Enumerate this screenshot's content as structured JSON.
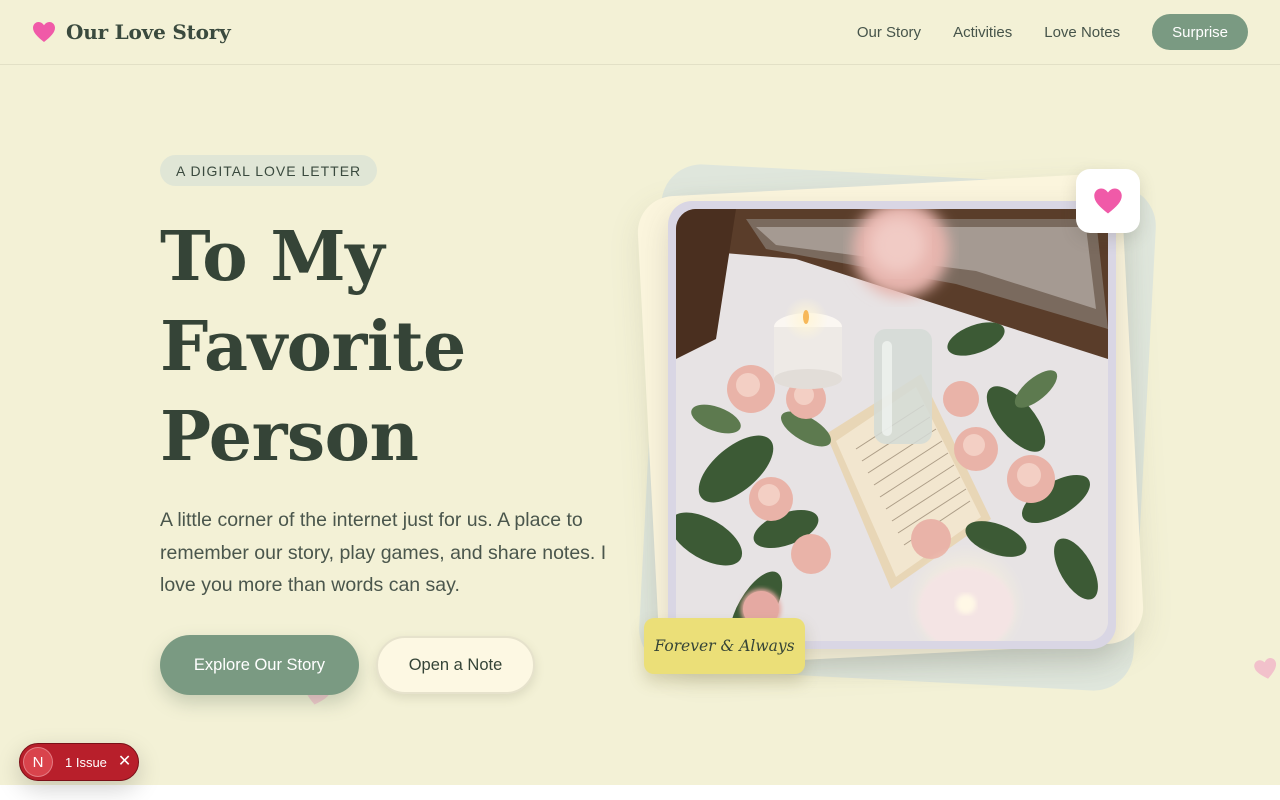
{
  "header": {
    "brand_title": "Our Love Story",
    "brand_icon": "heart-icon",
    "nav": [
      {
        "label": "Our Story"
      },
      {
        "label": "Activities"
      },
      {
        "label": "Love Notes"
      }
    ],
    "cta_label": "Surprise"
  },
  "hero": {
    "badge": "A DIGITAL LOVE LETTER",
    "title_lines": [
      "To My",
      "Favorite",
      "Person"
    ],
    "description": "A little corner of the internet just for us. A place to remember our story, play games, and share notes. I love you more than words can say.",
    "primary_button": "Explore Our Story",
    "secondary_button": "Open a Note"
  },
  "photo_card": {
    "caption": "Forever & Always",
    "badge_icon": "heart-icon"
  },
  "dev_overlay": {
    "avatar_letter": "N",
    "issues_label": "1 Issue",
    "close_icon": "close-icon"
  },
  "colors": {
    "background": "#f3f1d6",
    "accent_green": "#7a9a82",
    "heart_pink": "#f05aa8",
    "issue_red": "#b81f2b",
    "caption_yellow": "#ebdf78"
  }
}
